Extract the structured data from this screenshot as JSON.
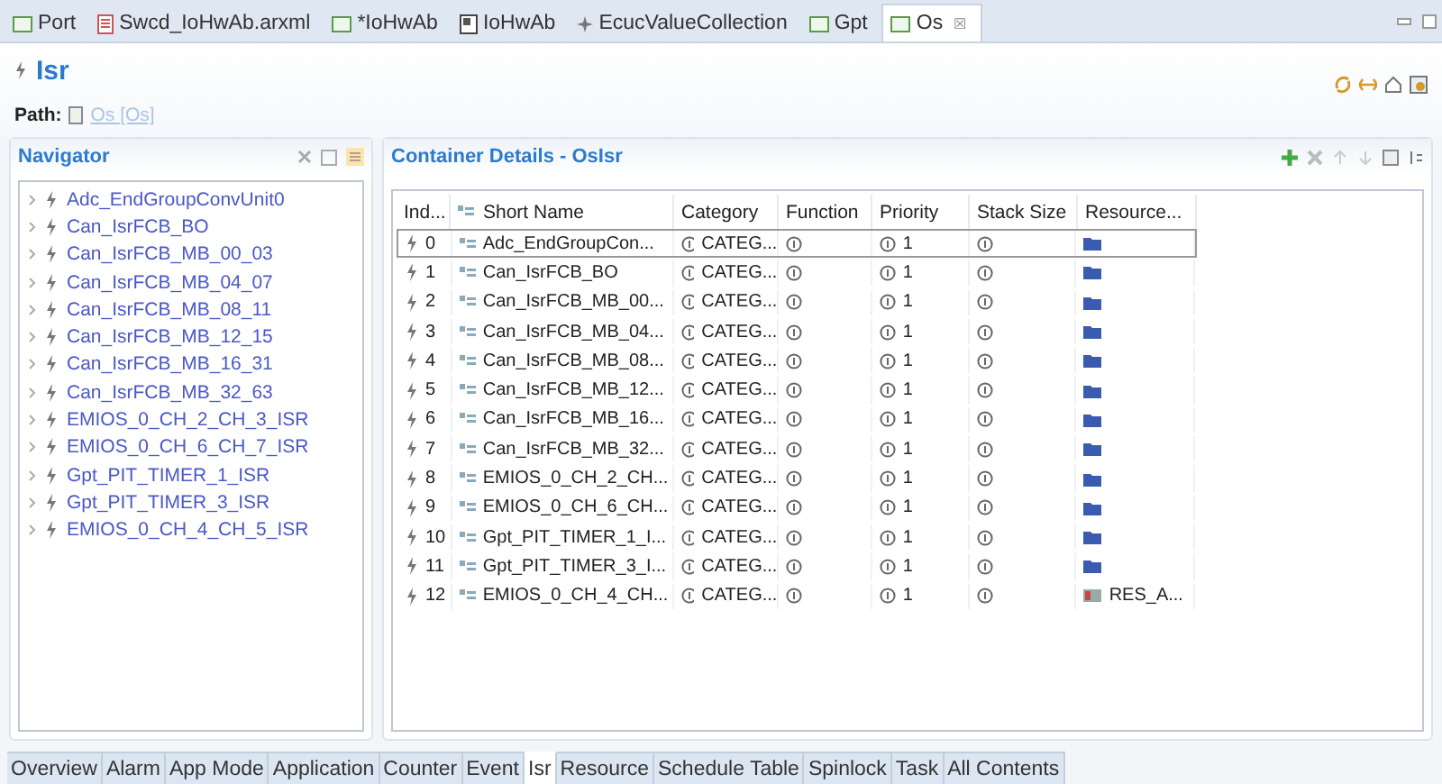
{
  "editor_tabs": [
    {
      "label": "Port",
      "kind": "module",
      "selected": false
    },
    {
      "label": "Swcd_IoHwAb.arxml",
      "kind": "file",
      "selected": false
    },
    {
      "label": "*IoHwAb",
      "kind": "module",
      "selected": false
    },
    {
      "label": "IoHwAb",
      "kind": "book",
      "selected": false
    },
    {
      "label": "EcucValueCollection",
      "kind": "collection",
      "selected": false
    },
    {
      "label": "Gpt",
      "kind": "module",
      "selected": false
    },
    {
      "label": "Os",
      "kind": "module",
      "selected": true,
      "close": "☒"
    }
  ],
  "header": {
    "title": "Isr",
    "path_label": "Path:",
    "path_link": "Os [Os]"
  },
  "navigator": {
    "title": "Navigator",
    "items": [
      "Adc_EndGroupConvUnit0",
      "Can_IsrFCB_BO",
      "Can_IsrFCB_MB_00_03",
      "Can_IsrFCB_MB_04_07",
      "Can_IsrFCB_MB_08_11",
      "Can_IsrFCB_MB_12_15",
      "Can_IsrFCB_MB_16_31",
      "Can_IsrFCB_MB_32_63",
      "EMIOS_0_CH_2_CH_3_ISR",
      "EMIOS_0_CH_6_CH_7_ISR",
      "Gpt_PIT_TIMER_1_ISR",
      "Gpt_PIT_TIMER_3_ISR",
      "EMIOS_0_CH_4_CH_5_ISR"
    ]
  },
  "details": {
    "title": "Container Details - OsIsr",
    "columns": [
      "Ind...",
      "Short Name",
      "Category",
      "Function",
      "Priority",
      "Stack Size",
      "Resource..."
    ],
    "rows": [
      {
        "index": "0",
        "name": "Adc_EndGroupCon...",
        "category": "CATEG...",
        "priority": "1",
        "selected": true
      },
      {
        "index": "1",
        "name": "Can_IsrFCB_BO",
        "category": "CATEG...",
        "priority": "1",
        "selected": false
      },
      {
        "index": "2",
        "name": "Can_IsrFCB_MB_00...",
        "category": "CATEG...",
        "priority": "1",
        "selected": false
      },
      {
        "index": "3",
        "name": "Can_IsrFCB_MB_04...",
        "category": "CATEG...",
        "priority": "1",
        "selected": false
      },
      {
        "index": "4",
        "name": "Can_IsrFCB_MB_08...",
        "category": "CATEG...",
        "priority": "1",
        "selected": false
      },
      {
        "index": "5",
        "name": "Can_IsrFCB_MB_12...",
        "category": "CATEG...",
        "priority": "1",
        "selected": false
      },
      {
        "index": "6",
        "name": "Can_IsrFCB_MB_16...",
        "category": "CATEG...",
        "priority": "1",
        "selected": false
      },
      {
        "index": "7",
        "name": "Can_IsrFCB_MB_32...",
        "category": "CATEG...",
        "priority": "1",
        "selected": false
      },
      {
        "index": "8",
        "name": "EMIOS_0_CH_2_CH...",
        "category": "CATEG...",
        "priority": "1",
        "selected": false
      },
      {
        "index": "9",
        "name": "EMIOS_0_CH_6_CH...",
        "category": "CATEG...",
        "priority": "1",
        "selected": false
      },
      {
        "index": "10",
        "name": "Gpt_PIT_TIMER_1_I...",
        "category": "CATEG...",
        "priority": "1",
        "selected": false
      },
      {
        "index": "11",
        "name": "Gpt_PIT_TIMER_3_I...",
        "category": "CATEG...",
        "priority": "1",
        "selected": false
      },
      {
        "index": "12",
        "name": "EMIOS_0_CH_4_CH...",
        "category": "CATEG...",
        "priority": "1",
        "selected": false,
        "resource": "RES_A..."
      }
    ]
  },
  "page_tabs": [
    {
      "label": "Overview",
      "selected": false
    },
    {
      "label": "Alarm",
      "selected": false
    },
    {
      "label": "App Mode",
      "selected": false
    },
    {
      "label": "Application",
      "selected": false
    },
    {
      "label": "Counter",
      "selected": false
    },
    {
      "label": "Event",
      "selected": false
    },
    {
      "label": "Isr",
      "selected": true
    },
    {
      "label": "Resource",
      "selected": false
    },
    {
      "label": "Schedule Table",
      "selected": false
    },
    {
      "label": "Spinlock",
      "selected": false
    },
    {
      "label": "Task",
      "selected": false
    },
    {
      "label": "All Contents",
      "selected": false
    }
  ]
}
